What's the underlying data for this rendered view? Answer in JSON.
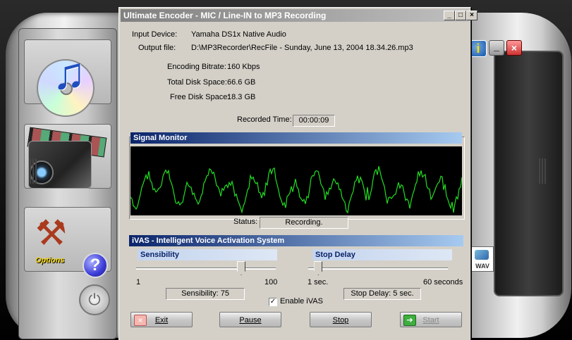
{
  "window": {
    "title": "Ultimate Encoder - MIC / Line-IN to MP3 Recording",
    "min_glyph": "_",
    "max_glyph": "□",
    "close_glyph": "×"
  },
  "info": {
    "input_device_label": "Input Device:",
    "input_device_value": "Yamaha DS1x Native Audio",
    "output_file_label": "Output file:",
    "output_file_value": "D:\\MP3Recorder\\RecFile - Sunday, June 13, 2004 18.34.26.mp3",
    "bitrate_label": "Encoding Bitrate:",
    "bitrate_value": "160 Kbps",
    "total_disk_label": "Total Disk Space:",
    "total_disk_value": "66.6 GB",
    "free_disk_label": "Free Disk Space:",
    "free_disk_value": "18.3 GB",
    "recorded_time_label": "Recorded Time:",
    "recorded_time_value": "00:00:09"
  },
  "signal_monitor": {
    "title": "Signal Monitor",
    "status_label": "Status:",
    "status_value": "Recording.",
    "wave_color": "#22dd22"
  },
  "ivas": {
    "title": "iVAS - Intelligent Voice Activation System",
    "sensibility": {
      "title": "Sensibility",
      "min_label": "1",
      "max_label": "100",
      "min": 1,
      "max": 100,
      "value": 75,
      "readout": "Sensibility: 75"
    },
    "stop_delay": {
      "title": "Stop Delay",
      "min_label": "1 sec.",
      "max_label": "60 seconds",
      "min": 1,
      "max": 60,
      "value": 5,
      "readout": "Stop Delay: 5 sec."
    },
    "enable_label": "Enable iVAS",
    "enable_checked_glyph": "✓"
  },
  "buttons": {
    "exit": "Exit",
    "pause": "Pause",
    "stop": "Stop",
    "start": "Start"
  },
  "skin": {
    "options_label": "Options",
    "help_glyph": "?",
    "power_glyph": "⏻",
    "info_glyph": "i",
    "min_glyph": "_",
    "close_glyph": "×",
    "music_note_glyph": "♫",
    "tools_glyph": "⚒",
    "wav_label": "WAV"
  },
  "colors": {
    "titlebar_inactive_start": "#808080",
    "section_bar_start": "#0a246a",
    "section_bar_end": "#a6caf0",
    "sub_bar": "#c4d4ee"
  }
}
